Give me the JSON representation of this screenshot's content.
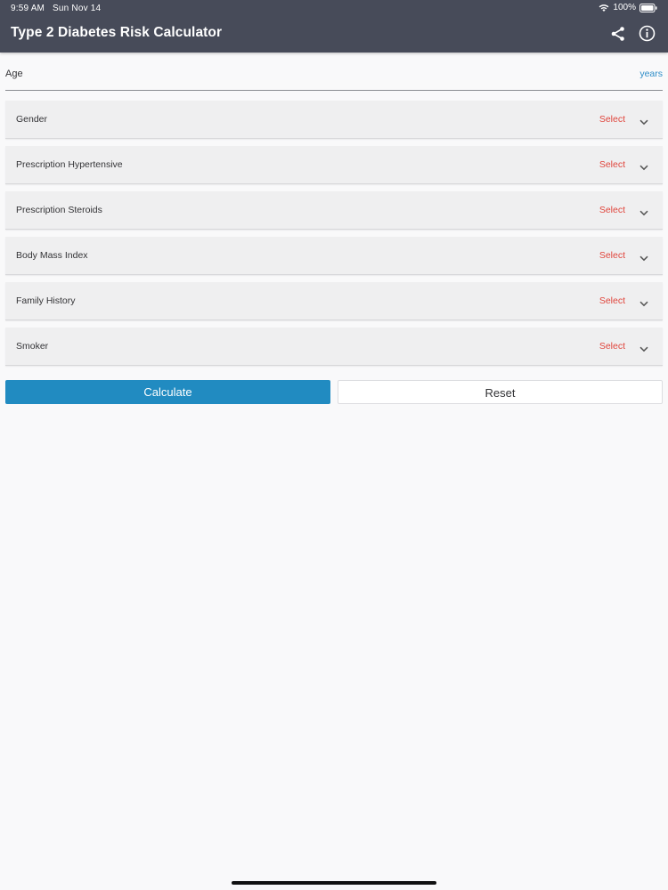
{
  "status_bar": {
    "time": "9:59 AM",
    "date": "Sun Nov 14",
    "battery": "100%"
  },
  "header": {
    "title": "Type 2 Diabetes Risk Calculator",
    "actions": [
      "share-icon",
      "info-icon"
    ]
  },
  "age": {
    "label": "Age",
    "value": "",
    "unit": "years"
  },
  "fields": [
    {
      "label": "Gender",
      "value": "Select"
    },
    {
      "label": "Prescription Hypertensive",
      "value": "Select"
    },
    {
      "label": "Prescription Steroids",
      "value": "Select"
    },
    {
      "label": "Body Mass Index",
      "value": "Select"
    },
    {
      "label": "Family History",
      "value": "Select"
    },
    {
      "label": "Smoker",
      "value": "Select"
    }
  ],
  "buttons": {
    "calculate": "Calculate",
    "reset": "Reset"
  },
  "colors": {
    "header_bg": "#474b59",
    "accent_blue": "#218bc1",
    "select_red": "#e0453c",
    "unit_blue": "#2e8dc8"
  }
}
